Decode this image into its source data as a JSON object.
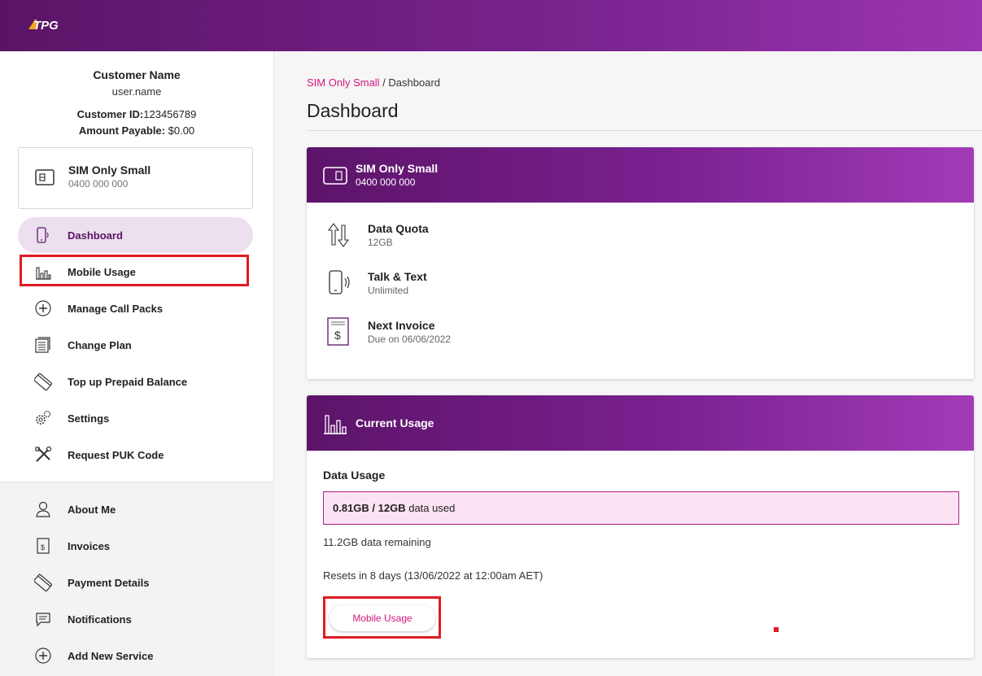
{
  "header": {
    "logo_text": "TPG",
    "brand_color": "#6d1c80",
    "accent_color": "#d6157f"
  },
  "customer": {
    "name": "Customer Name",
    "username": "user.name",
    "id_label": "Customer ID:",
    "id_value": "123456789",
    "amount_label": "Amount Payable:",
    "amount_value": "$0.00"
  },
  "service": {
    "plan": "SIM Only Small",
    "number": "0400 000 000",
    "icon": "sim-card-icon"
  },
  "nav": {
    "primary": [
      {
        "label": "Dashboard",
        "icon": "phone-icon",
        "active": true
      },
      {
        "label": "Mobile Usage",
        "icon": "bar-chart-icon"
      },
      {
        "label": "Manage Call Packs",
        "icon": "plus-circle-icon"
      },
      {
        "label": "Change Plan",
        "icon": "document-stack-icon"
      },
      {
        "label": "Top up Prepaid Balance",
        "icon": "card-icon"
      },
      {
        "label": "Settings",
        "icon": "gears-icon"
      },
      {
        "label": "Request PUK Code",
        "icon": "tools-icon"
      }
    ],
    "secondary": [
      {
        "label": "About Me",
        "icon": "user-icon"
      },
      {
        "label": "Invoices",
        "icon": "invoice-icon"
      },
      {
        "label": "Payment Details",
        "icon": "card-icon"
      },
      {
        "label": "Notifications",
        "icon": "chat-icon"
      },
      {
        "label": "Add New Service",
        "icon": "plus-circle-icon"
      }
    ]
  },
  "breadcrumb": {
    "link": "SIM Only Small",
    "separator": " / ",
    "current": "Dashboard"
  },
  "page_title": "Dashboard",
  "plan_card": {
    "title": "SIM Only Small",
    "number": "0400 000 000",
    "features": [
      {
        "title": "Data Quota",
        "sub": "12GB",
        "icon": "data-arrows-icon"
      },
      {
        "title": "Talk & Text",
        "sub": "Unlimited",
        "icon": "phone-icon"
      },
      {
        "title": "Next Invoice",
        "sub": "Due on 06/06/2022",
        "icon": "invoice-icon"
      }
    ]
  },
  "usage_card": {
    "title": "Current Usage",
    "section_title": "Data Usage",
    "used_bold": "0.81GB / 12GB",
    "used_suffix": " data used",
    "used_gb": 0.81,
    "quota_gb": 12,
    "remaining": "11.2GB data remaining",
    "reset": "Resets in 8 days (13/06/2022 at 12:00am AET)",
    "button": "Mobile Usage"
  }
}
